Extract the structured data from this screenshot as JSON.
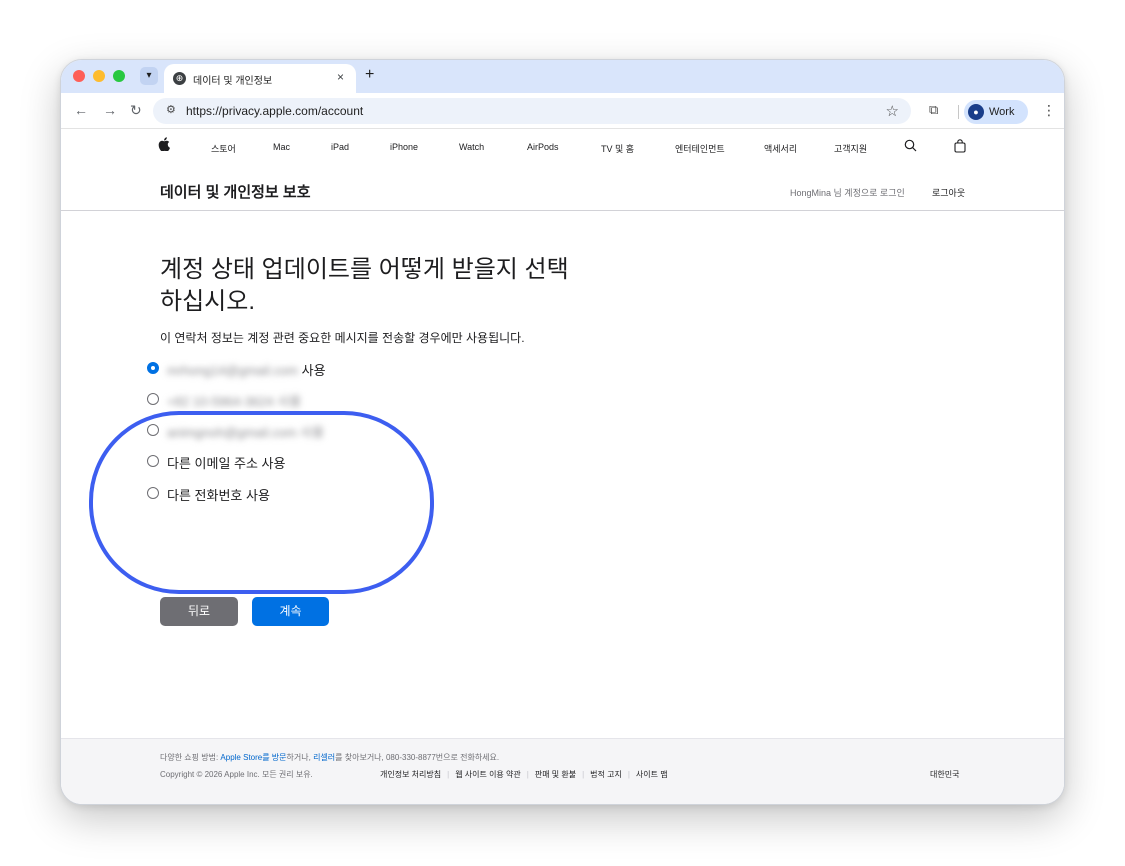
{
  "browser": {
    "tab": {
      "title": "데이터 및 개인정보",
      "close": "×"
    },
    "new_tab": "+",
    "url": "https://privacy.apple.com/account",
    "profile": {
      "label": "Work"
    }
  },
  "global_nav": {
    "items": [
      "스토어",
      "Mac",
      "iPad",
      "iPhone",
      "Watch",
      "AirPods",
      "TV 및 홈",
      "엔터테인먼트",
      "액세서리",
      "고객지원"
    ]
  },
  "local_nav": {
    "title": "데이터 및 개인정보 보호",
    "signed_in": "HongMina 님 계정으로 로그인",
    "logout": "로그아웃"
  },
  "main": {
    "heading": "계정 상태 업데이트를 어떻게 받을지 선택하십시오.",
    "subtext": "이 연락처 정보는 계정 관련 중요한 메시지를 전송할 경우에만 사용됩니다.",
    "options": [
      {
        "value": "mrhong14@gmail.com",
        "suffix": "사용",
        "selected": true
      },
      {
        "value": "+82 10-5964-3624",
        "suffix": "사용",
        "selected": false
      },
      {
        "value": "animgnoh@gmail.com",
        "suffix": "사용",
        "selected": false
      },
      {
        "value": "",
        "suffix": "다른 이메일 주소 사용",
        "selected": false
      },
      {
        "value": "",
        "suffix": "다른 전화번호 사용",
        "selected": false
      }
    ],
    "back_button": "뒤로",
    "continue_button": "계속"
  },
  "footer": {
    "line1_prefix": "다양한 쇼핑 방법: ",
    "line1_link1": "Apple Store를 방문",
    "line1_mid": "하거나, ",
    "line1_link2": "리셀러",
    "line1_suffix": "를 찾아보거나, 080-330-8877번으로 전화하세요.",
    "copyright": "Copyright © 2026 Apple Inc. 모든 권리 보유.",
    "links": [
      "개인정보 처리방침",
      "웹 사이트 이용 약관",
      "판매 및 환불",
      "법적 고지",
      "사이트 맵"
    ],
    "region": "대한민국"
  },
  "colors": {
    "accent": "#0071e3",
    "highlight_ring": "#3d5ef0",
    "tabstrip": "#d9e5fb"
  }
}
